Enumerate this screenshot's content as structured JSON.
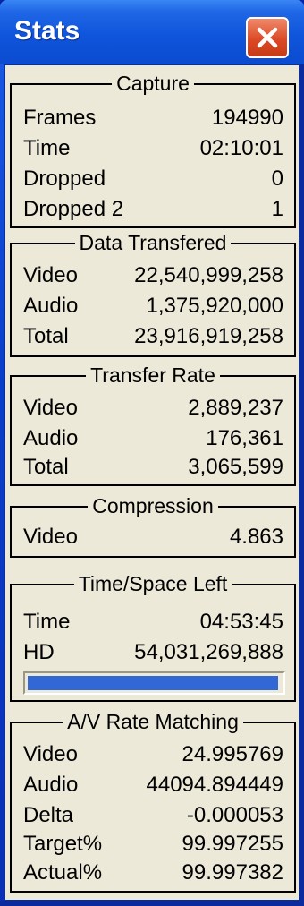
{
  "window": {
    "title": "Stats"
  },
  "capture": {
    "legend": "Capture",
    "rows": [
      {
        "label": "Frames",
        "value": "194990"
      },
      {
        "label": "Time",
        "value": "02:10:01"
      },
      {
        "label": "Dropped",
        "value": "0"
      },
      {
        "label": "Dropped 2",
        "value": "1"
      }
    ]
  },
  "data_transfered": {
    "legend": "Data Transfered",
    "rows": [
      {
        "label": "Video",
        "value": "22,540,999,258"
      },
      {
        "label": "Audio",
        "value": "1,375,920,000"
      },
      {
        "label": "Total",
        "value": "23,916,919,258"
      }
    ]
  },
  "transfer_rate": {
    "legend": "Transfer Rate",
    "rows": [
      {
        "label": "Video",
        "value": "2,889,237"
      },
      {
        "label": "Audio",
        "value": "176,361"
      },
      {
        "label": "Total",
        "value": "3,065,599"
      }
    ]
  },
  "compression": {
    "legend": "Compression",
    "rows": [
      {
        "label": "Video",
        "value": "4.863"
      }
    ]
  },
  "time_space_left": {
    "legend": "Time/Space Left",
    "rows": [
      {
        "label": "Time",
        "value": "04:53:45"
      },
      {
        "label": "HD",
        "value": "54,031,269,888"
      }
    ],
    "progress_fraction": 0.99
  },
  "av_rate_matching": {
    "legend": "A/V Rate Matching",
    "rows": [
      {
        "label": "Video",
        "value": "24.995769"
      },
      {
        "label": "Audio",
        "value": "44094.894449"
      },
      {
        "label": "Delta",
        "value": "-0.000053"
      },
      {
        "label": "Target%",
        "value": "99.997255"
      },
      {
        "label": "Actual%",
        "value": "99.997382"
      }
    ]
  },
  "colors": {
    "title_bar": "#0b4bd0",
    "close_button": "#dc4a25",
    "progress_fill": "#3268d6",
    "panel_bg": "#ece9d8"
  },
  "icons": {
    "close": "close-icon"
  }
}
